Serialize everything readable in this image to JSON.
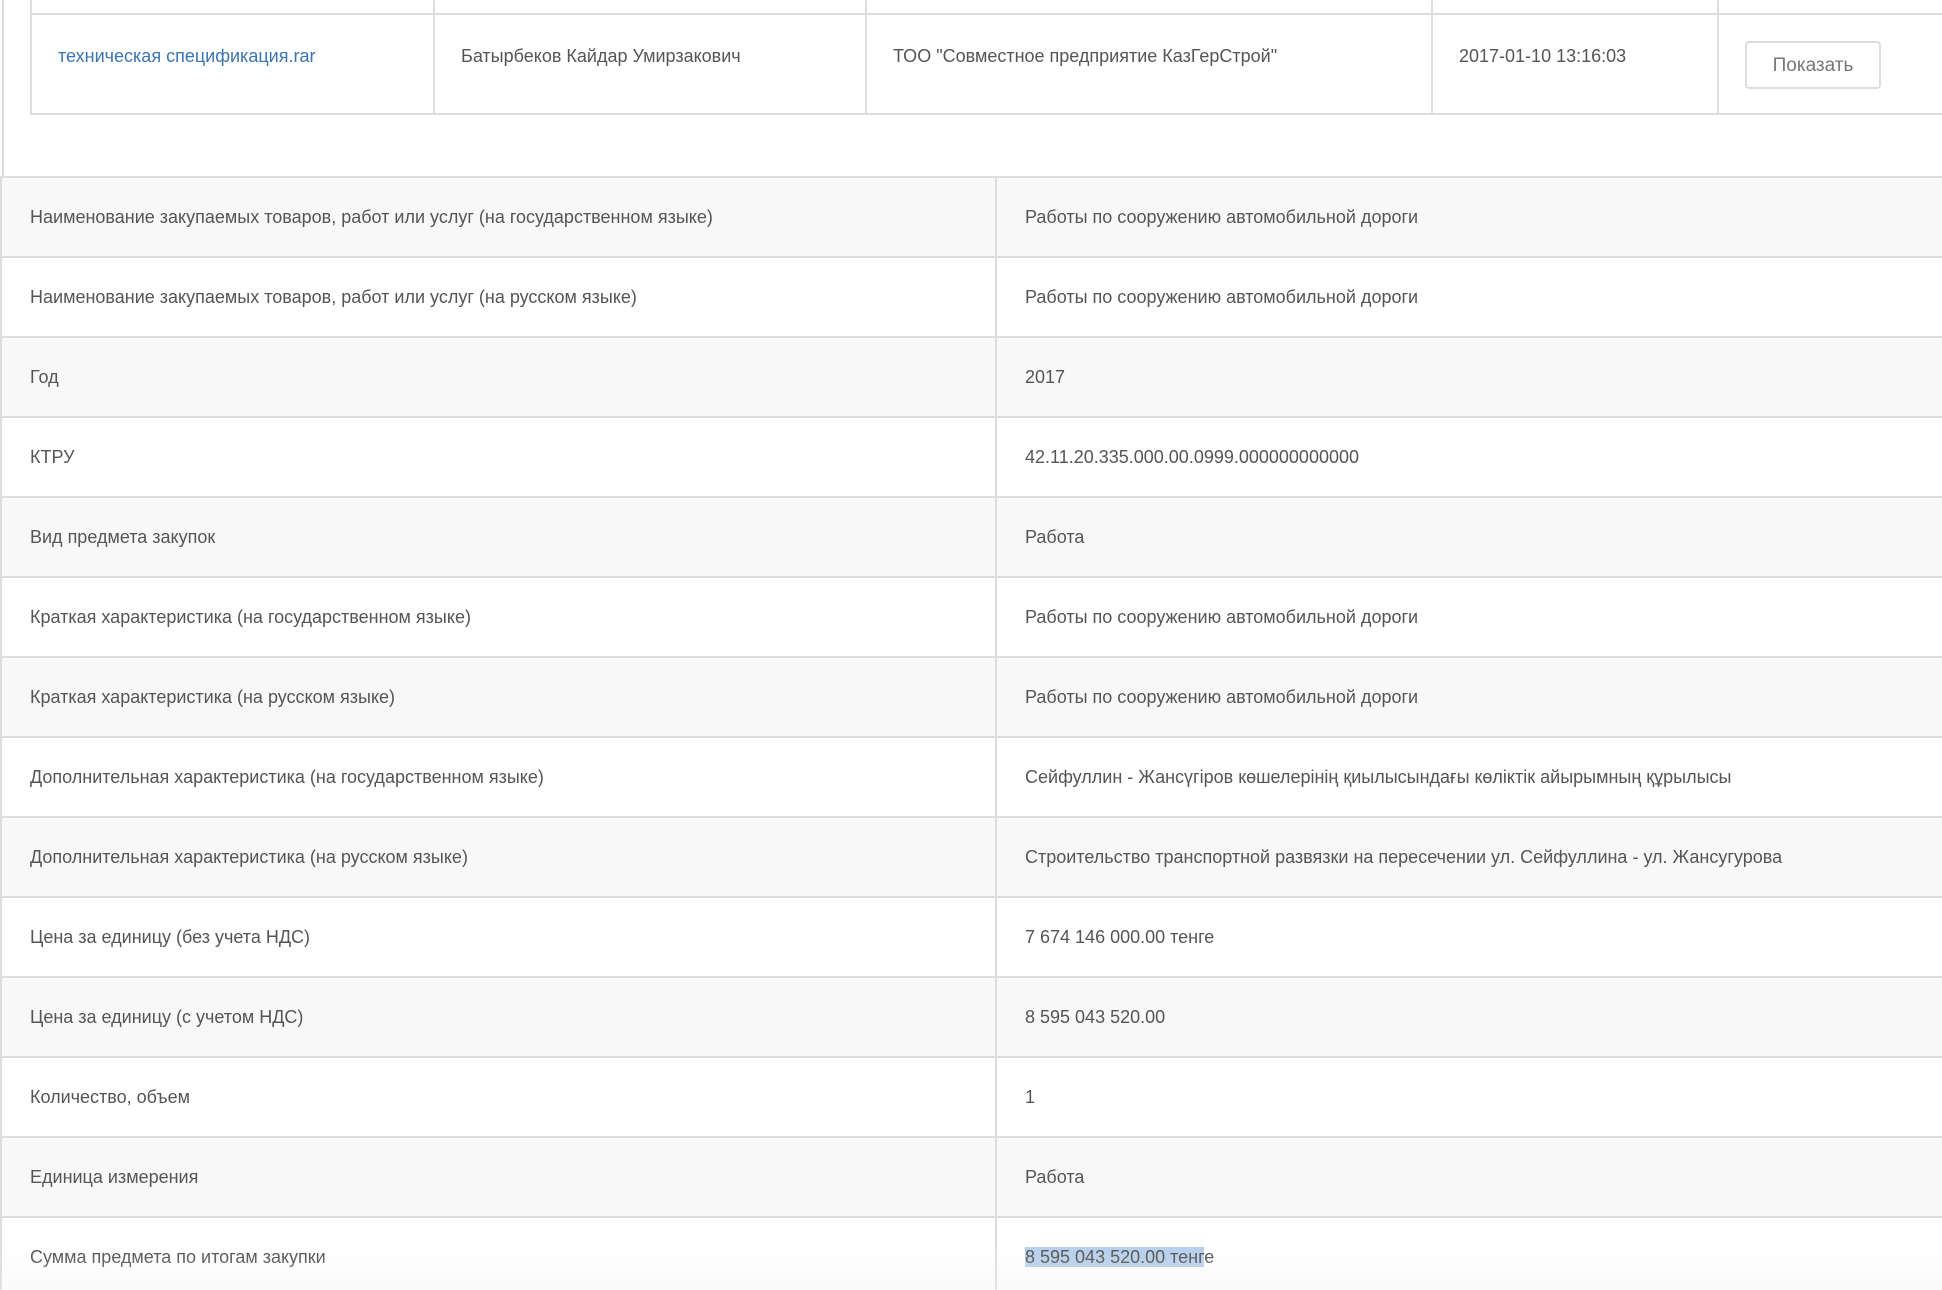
{
  "files": {
    "rows": [
      {
        "file_name": "техническая спецификация.rar",
        "uploaded_by": "Батырбеков Кайдар Умирзакович",
        "organization": "ТОО \"Совместное предприятие КазГерСтрой\"",
        "date": "2017-01-10 13:16:03",
        "action_label": "Показать"
      }
    ]
  },
  "details": {
    "rows": [
      {
        "label": "Наименование закупаемых товаров, работ или услуг (на государственном языке)",
        "value": "Работы по сооружению автомобильной дороги"
      },
      {
        "label": "Наименование закупаемых товаров, работ или услуг (на русском языке)",
        "value": "Работы по сооружению автомобильной дороги"
      },
      {
        "label": "Год",
        "value": "2017"
      },
      {
        "label": "КТРУ",
        "value": "42.11.20.335.000.00.0999.000000000000"
      },
      {
        "label": "Вид предмета закупок",
        "value": "Работа"
      },
      {
        "label": "Краткая характеристика (на государственном языке)",
        "value": "Работы по сооружению автомобильной дороги"
      },
      {
        "label": "Краткая характеристика (на русском языке)",
        "value": "Работы по сооружению автомобильной дороги"
      },
      {
        "label": "Дополнительная характеристика (на государственном языке)",
        "value": "Сейфуллин - Жансүгіров көшелерінің қиылысындағы көліктік айырымның құрылысы"
      },
      {
        "label": "Дополнительная характеристика (на русском языке)",
        "value": "Строительство транспортной развязки на пересечении ул. Сейфуллина - ул. Жансугурова"
      },
      {
        "label": "Цена за единицу (без учета НДС)",
        "value": "7 674 146 000.00 тенге"
      },
      {
        "label": "Цена за единицу (с учетом НДС)",
        "value": "8 595 043 520.00"
      },
      {
        "label": "Количество, объем",
        "value": "1"
      },
      {
        "label": "Единица измерения",
        "value": "Работа"
      }
    ],
    "total": {
      "label": "Сумма предмета по итогам закупки",
      "value_selected": "8 595 043 520.00 тенг",
      "value_rest": "е"
    }
  },
  "colors": {
    "link": "#3a75b0",
    "border": "#dddddd",
    "row_alt": "#f8f8f8",
    "selection": "#b8d0ec"
  }
}
